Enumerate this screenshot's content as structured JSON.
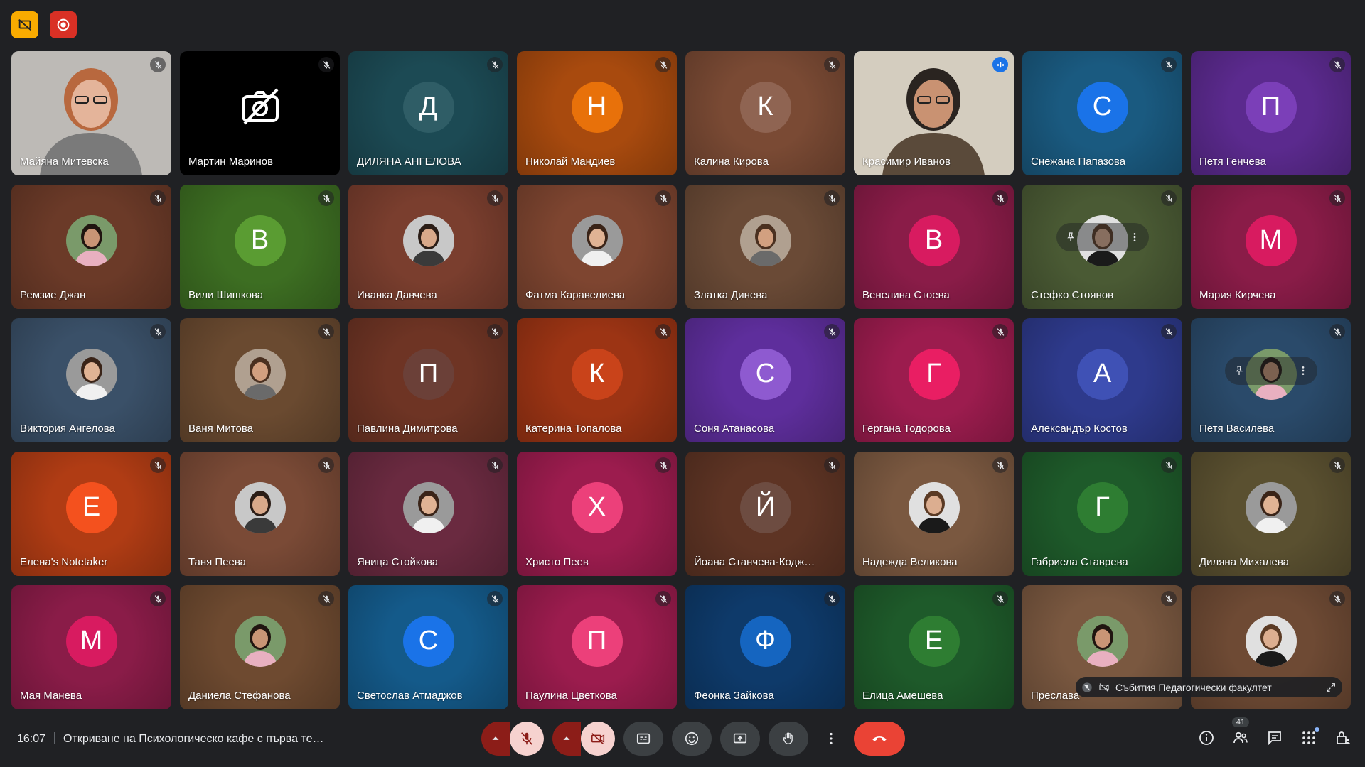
{
  "meeting": {
    "time": "16:07",
    "title": "Откриване на Психологическо кафе с първа те…",
    "people_count": "41"
  },
  "pip": {
    "label": "Събития Педагогически факултет"
  },
  "participants": [
    {
      "name": "Майяна Митевска",
      "type": "photo",
      "bg": "#8a8784",
      "muted": true
    },
    {
      "name": "Мартин Маринов",
      "type": "camoff",
      "bg": "#000000",
      "muted": true
    },
    {
      "name": "ДИЛЯНА АНГЕЛОВА",
      "type": "letter",
      "letter": "Д",
      "bg": "#1c4a54",
      "avatar": "#2f5d66",
      "muted": true
    },
    {
      "name": "Николай Мандиев",
      "type": "letter",
      "letter": "Н",
      "bg": "#a84a0e",
      "avatar": "#e8710a",
      "muted": true
    },
    {
      "name": "Калина Кирова",
      "type": "letter",
      "letter": "К",
      "bg": "#7a4a34",
      "avatar": "#8f6452",
      "muted": true
    },
    {
      "name": "Красимир Иванов",
      "type": "photo",
      "bg": "#c7c0b4",
      "muted": false,
      "speaking": true
    },
    {
      "name": "Снежана Папазова",
      "type": "letter",
      "letter": "С",
      "bg": "#1a5a80",
      "avatar": "#1a73e8",
      "muted": true
    },
    {
      "name": "Петя Генчева",
      "type": "letter",
      "letter": "П",
      "bg": "#5b2a8e",
      "avatar": "#7b3fb8",
      "muted": true
    },
    {
      "name": "Ремзие Джан",
      "type": "avatarphoto",
      "bg": "#6b3a28",
      "muted": true
    },
    {
      "name": "Вили Шишкова",
      "type": "letter",
      "letter": "В",
      "bg": "#3d6e22",
      "avatar": "#5a9c32",
      "muted": true
    },
    {
      "name": "Иванка Давчева",
      "type": "avatarphoto",
      "bg": "#7a3e2e",
      "muted": true
    },
    {
      "name": "Фатма Каравелиева",
      "type": "avatarphoto",
      "bg": "#7e4530",
      "muted": true
    },
    {
      "name": "Златка Динева",
      "type": "avatarphoto",
      "bg": "#6a4a36",
      "muted": true
    },
    {
      "name": "Венелина Стоева",
      "type": "letter",
      "letter": "В",
      "bg": "#8a1c48",
      "avatar": "#d81b60",
      "muted": true
    },
    {
      "name": "Стефко Стоянов",
      "type": "avatarphoto",
      "bg": "#4a5a34",
      "muted": true,
      "hover": true
    },
    {
      "name": "Мария Кирчева",
      "type": "letter",
      "letter": "М",
      "bg": "#8a1c48",
      "avatar": "#d81b60",
      "muted": true
    },
    {
      "name": "Виктория Ангелова",
      "type": "avatarphoto",
      "bg": "#3a5068",
      "muted": true
    },
    {
      "name": "Ваня Митова",
      "type": "avatarphoto",
      "bg": "#6a4a30",
      "muted": true
    },
    {
      "name": "Павлина Димитрова",
      "type": "letter",
      "letter": "П",
      "bg": "#6e3424",
      "avatar": "#6b4038",
      "muted": true
    },
    {
      "name": "Катерина Топалова",
      "type": "letter",
      "letter": "К",
      "bg": "#9c3414",
      "avatar": "#c9431a",
      "muted": true
    },
    {
      "name": "Соня Атанасова",
      "type": "letter",
      "letter": "С",
      "bg": "#5e2e9c",
      "avatar": "#8e5ad0",
      "muted": true
    },
    {
      "name": "Гергана Тодорова",
      "type": "letter",
      "letter": "Г",
      "bg": "#9c1c4e",
      "avatar": "#e91e63",
      "muted": true
    },
    {
      "name": "Александър Костов",
      "type": "letter",
      "letter": "А",
      "bg": "#2e3a8c",
      "avatar": "#3f51b5",
      "muted": true
    },
    {
      "name": "Петя Василева",
      "type": "avatarphoto",
      "bg": "#2a4a6a",
      "muted": true,
      "hover": true
    },
    {
      "name": "Елена's Notetaker",
      "type": "letter",
      "letter": "Е",
      "bg": "#b03c14",
      "avatar": "#f4511e",
      "muted": true
    },
    {
      "name": "Таня Пеева",
      "type": "avatarphoto",
      "bg": "#7a4a36",
      "muted": true
    },
    {
      "name": "Яница Стойкова",
      "type": "avatarphoto",
      "bg": "#6a2a40",
      "muted": true
    },
    {
      "name": "Христо Пеев",
      "type": "letter",
      "letter": "Х",
      "bg": "#9c1c4e",
      "avatar": "#ec407a",
      "muted": true
    },
    {
      "name": "Йоана Станчева-Кодж…",
      "type": "letter",
      "letter": "Й",
      "bg": "#5e3424",
      "avatar": "#6d4c41",
      "muted": true
    },
    {
      "name": "Надежда Великова",
      "type": "avatarphoto",
      "bg": "#7a5840",
      "muted": true
    },
    {
      "name": "Габриела Ставрева",
      "type": "letter",
      "letter": "Г",
      "bg": "#1e5a2a",
      "avatar": "#2e7d32",
      "muted": true
    },
    {
      "name": "Диляна Михалева",
      "type": "avatarphoto",
      "bg": "#5a5030",
      "muted": true
    },
    {
      "name": "Мая Манева",
      "type": "letter",
      "letter": "М",
      "bg": "#8a1c48",
      "avatar": "#d81b60",
      "muted": true
    },
    {
      "name": "Даниела Стефанова",
      "type": "avatarphoto",
      "bg": "#6e4a30",
      "muted": true
    },
    {
      "name": "Светослав Атмаджов",
      "type": "letter",
      "letter": "С",
      "bg": "#145a8a",
      "avatar": "#1a73e8",
      "muted": true
    },
    {
      "name": "Паулина Цветкова",
      "type": "letter",
      "letter": "П",
      "bg": "#9c1c4e",
      "avatar": "#ec407a",
      "muted": true
    },
    {
      "name": "Феонка Зайкова",
      "type": "letter",
      "letter": "Ф",
      "bg": "#0e3a6a",
      "avatar": "#1565c0",
      "muted": true
    },
    {
      "name": "Елица Амешева",
      "type": "letter",
      "letter": "Е",
      "bg": "#1e5a2a",
      "avatar": "#2e7d32",
      "muted": true
    },
    {
      "name": "Преслава",
      "type": "avatarphoto",
      "bg": "#7a5840",
      "muted": true
    },
    {
      "name": "",
      "type": "avatarphoto",
      "bg": "#6e4a34",
      "muted": true
    }
  ]
}
